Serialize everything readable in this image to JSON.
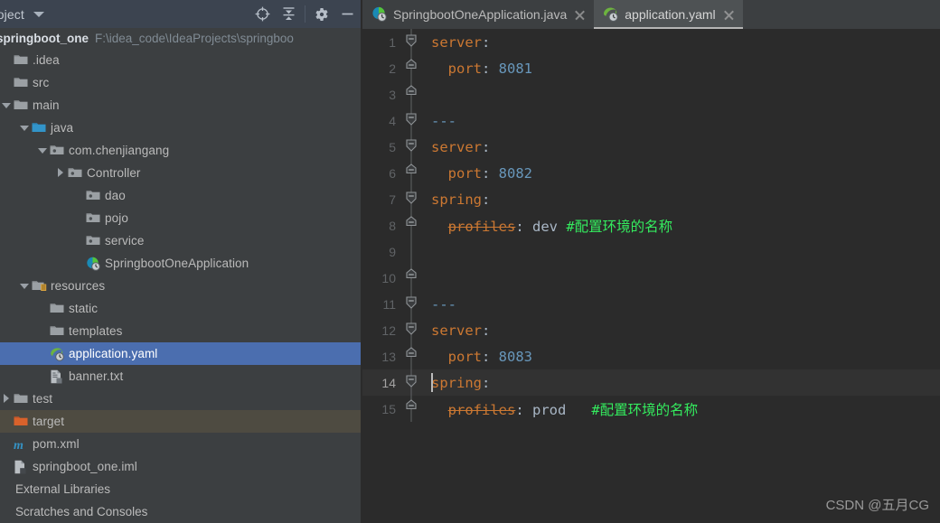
{
  "colors": {
    "sidebar_bg": "#3c3f41",
    "header_bg": "#3c4450",
    "editor_bg": "#2b2b2b",
    "tab_active_bg": "#4e5254",
    "selection_blue": "#4b6eaf",
    "hover_olive": "#4e4b41",
    "keyword_orange": "#cc7832",
    "number_blue": "#6897bb",
    "comment_green": "#34eb5e",
    "text_gray": "#a9b7c6",
    "line_number": "#606366"
  },
  "tool_window": {
    "title": "roject",
    "title_full": "Project",
    "actions": [
      {
        "name": "locate-icon",
        "tooltip": "Select Opened File"
      },
      {
        "name": "collapse-all-icon",
        "tooltip": "Collapse All"
      },
      {
        "name": "gear-icon",
        "tooltip": "Settings"
      },
      {
        "name": "minimize-icon",
        "tooltip": "Hide"
      }
    ]
  },
  "project": {
    "name": "springboot_one",
    "path": "F:\\idea_code\\IdeaProjects\\springboo"
  },
  "tree": [
    {
      "label": ".idea",
      "indent": 0,
      "arrow": "none",
      "icon": "folder-gray",
      "state": "normal"
    },
    {
      "label": "src",
      "indent": 0,
      "arrow": "none",
      "icon": "folder-gray",
      "state": "normal"
    },
    {
      "label": "main",
      "indent": 0,
      "arrow": "down",
      "icon": "folder-gray",
      "state": "normal"
    },
    {
      "label": "java",
      "indent": 1,
      "arrow": "down",
      "icon": "folder-blue",
      "state": "normal"
    },
    {
      "label": "com.chenjiangang",
      "indent": 2,
      "arrow": "down",
      "icon": "package",
      "state": "normal"
    },
    {
      "label": "Controller",
      "indent": 3,
      "arrow": "right",
      "icon": "package",
      "state": "normal"
    },
    {
      "label": "dao",
      "indent": 4,
      "arrow": "none",
      "icon": "package",
      "state": "normal"
    },
    {
      "label": "pojo",
      "indent": 4,
      "arrow": "none",
      "icon": "package",
      "state": "normal"
    },
    {
      "label": "service",
      "indent": 4,
      "arrow": "none",
      "icon": "package",
      "state": "normal"
    },
    {
      "label": "SpringbootOneApplication",
      "indent": 4,
      "arrow": "none",
      "icon": "spring-class",
      "state": "normal"
    },
    {
      "label": "resources",
      "indent": 1,
      "arrow": "down",
      "icon": "folder-res",
      "state": "normal"
    },
    {
      "label": "static",
      "indent": 2,
      "arrow": "none",
      "icon": "folder-gray",
      "state": "normal"
    },
    {
      "label": "templates",
      "indent": 2,
      "arrow": "none",
      "icon": "folder-gray",
      "state": "normal"
    },
    {
      "label": "application.yaml",
      "indent": 2,
      "arrow": "none",
      "icon": "spring-yaml",
      "state": "selected"
    },
    {
      "label": "banner.txt",
      "indent": 2,
      "arrow": "none",
      "icon": "text-file",
      "state": "normal"
    },
    {
      "label": "test",
      "indent": 0,
      "arrow": "right",
      "icon": "folder-gray",
      "state": "normal"
    },
    {
      "label": "target",
      "indent": 0,
      "arrow": "none",
      "icon": "folder-orange",
      "state": "highlight"
    },
    {
      "label": "pom.xml",
      "indent": 0,
      "arrow": "none",
      "icon": "maven",
      "state": "normal"
    },
    {
      "label": "springboot_one.iml",
      "indent": 0,
      "arrow": "none",
      "icon": "iml-file",
      "state": "normal"
    },
    {
      "label": "External Libraries",
      "indent": 0,
      "arrow": "none",
      "icon": "none",
      "state": "normal"
    },
    {
      "label": "Scratches and Consoles",
      "indent": 0,
      "arrow": "none",
      "icon": "none",
      "state": "normal"
    }
  ],
  "tabs": [
    {
      "label": "SpringbootOneApplication.java",
      "icon": "spring-class-icon",
      "active": false,
      "close": "close-icon"
    },
    {
      "label": "application.yaml",
      "icon": "spring-yaml-icon",
      "active": true,
      "close": "close-icon"
    }
  ],
  "editor": {
    "file": "application.yaml",
    "current_line": 14,
    "lines": [
      {
        "n": 1,
        "fold": "down",
        "tokens": [
          {
            "t": "server",
            "c": "key"
          },
          {
            "t": ":",
            "c": "punc"
          }
        ]
      },
      {
        "n": 2,
        "fold": "flat",
        "tokens": [
          {
            "t": "  ",
            "c": "punc"
          },
          {
            "t": "port",
            "c": "key"
          },
          {
            "t": ": ",
            "c": "punc"
          },
          {
            "t": "8081",
            "c": "num"
          }
        ]
      },
      {
        "n": 3,
        "fold": "flat",
        "tokens": []
      },
      {
        "n": 4,
        "fold": "down",
        "tokens": [
          {
            "t": "---",
            "c": "dash"
          }
        ]
      },
      {
        "n": 5,
        "fold": "down",
        "tokens": [
          {
            "t": "server",
            "c": "key"
          },
          {
            "t": ":",
            "c": "punc"
          }
        ]
      },
      {
        "n": 6,
        "fold": "flat",
        "tokens": [
          {
            "t": "  ",
            "c": "punc"
          },
          {
            "t": "port",
            "c": "key"
          },
          {
            "t": ": ",
            "c": "punc"
          },
          {
            "t": "8082",
            "c": "num"
          }
        ]
      },
      {
        "n": 7,
        "fold": "down",
        "tokens": [
          {
            "t": "spring",
            "c": "key"
          },
          {
            "t": ":",
            "c": "punc"
          }
        ]
      },
      {
        "n": 8,
        "fold": "flat",
        "tokens": [
          {
            "t": "  ",
            "c": "punc"
          },
          {
            "t": "profiles",
            "c": "key-strike"
          },
          {
            "t": ": ",
            "c": "punc"
          },
          {
            "t": "dev",
            "c": "val"
          },
          {
            "t": " ",
            "c": "punc"
          },
          {
            "t": "#配置环境的名称",
            "c": "com"
          }
        ]
      },
      {
        "n": 9,
        "fold": "none",
        "tokens": []
      },
      {
        "n": 10,
        "fold": "flat",
        "tokens": []
      },
      {
        "n": 11,
        "fold": "down",
        "tokens": [
          {
            "t": "---",
            "c": "dash"
          }
        ]
      },
      {
        "n": 12,
        "fold": "down",
        "tokens": [
          {
            "t": "server",
            "c": "key"
          },
          {
            "t": ":",
            "c": "punc"
          }
        ]
      },
      {
        "n": 13,
        "fold": "flat",
        "tokens": [
          {
            "t": "  ",
            "c": "punc"
          },
          {
            "t": "port",
            "c": "key"
          },
          {
            "t": ": ",
            "c": "punc"
          },
          {
            "t": "8083",
            "c": "num"
          }
        ]
      },
      {
        "n": 14,
        "fold": "down",
        "tokens": [
          {
            "t": "spring",
            "c": "key"
          },
          {
            "t": ":",
            "c": "punc"
          }
        ]
      },
      {
        "n": 15,
        "fold": "flat",
        "tokens": [
          {
            "t": "  ",
            "c": "punc"
          },
          {
            "t": "profiles",
            "c": "key-strike"
          },
          {
            "t": ": ",
            "c": "punc"
          },
          {
            "t": "prod",
            "c": "val"
          },
          {
            "t": "   ",
            "c": "punc"
          },
          {
            "t": "#配置环境的名称",
            "c": "com"
          }
        ]
      }
    ]
  },
  "watermark": "CSDN @五月CG"
}
